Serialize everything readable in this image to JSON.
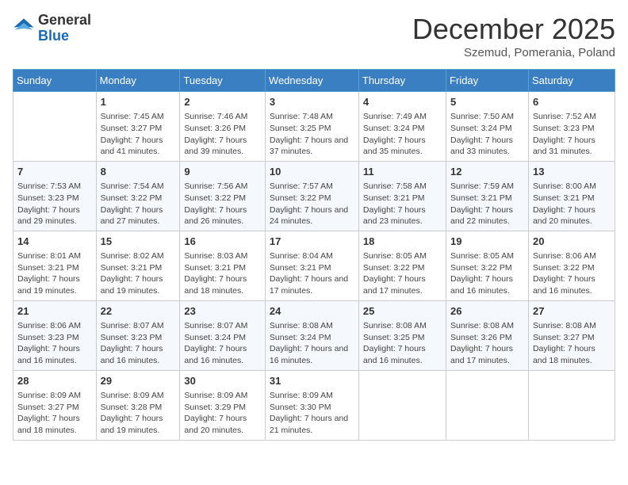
{
  "header": {
    "logo_general": "General",
    "logo_blue": "Blue",
    "month_title": "December 2025",
    "subtitle": "Szemud, Pomerania, Poland"
  },
  "days_of_week": [
    "Sunday",
    "Monday",
    "Tuesday",
    "Wednesday",
    "Thursday",
    "Friday",
    "Saturday"
  ],
  "weeks": [
    [
      {
        "day": "",
        "sunrise": "",
        "sunset": "",
        "daylight": ""
      },
      {
        "day": "1",
        "sunrise": "7:45 AM",
        "sunset": "3:27 PM",
        "daylight": "7 hours and 41 minutes."
      },
      {
        "day": "2",
        "sunrise": "7:46 AM",
        "sunset": "3:26 PM",
        "daylight": "7 hours and 39 minutes."
      },
      {
        "day": "3",
        "sunrise": "7:48 AM",
        "sunset": "3:25 PM",
        "daylight": "7 hours and 37 minutes."
      },
      {
        "day": "4",
        "sunrise": "7:49 AM",
        "sunset": "3:24 PM",
        "daylight": "7 hours and 35 minutes."
      },
      {
        "day": "5",
        "sunrise": "7:50 AM",
        "sunset": "3:24 PM",
        "daylight": "7 hours and 33 minutes."
      },
      {
        "day": "6",
        "sunrise": "7:52 AM",
        "sunset": "3:23 PM",
        "daylight": "7 hours and 31 minutes."
      }
    ],
    [
      {
        "day": "7",
        "sunrise": "7:53 AM",
        "sunset": "3:23 PM",
        "daylight": "7 hours and 29 minutes."
      },
      {
        "day": "8",
        "sunrise": "7:54 AM",
        "sunset": "3:22 PM",
        "daylight": "7 hours and 27 minutes."
      },
      {
        "day": "9",
        "sunrise": "7:56 AM",
        "sunset": "3:22 PM",
        "daylight": "7 hours and 26 minutes."
      },
      {
        "day": "10",
        "sunrise": "7:57 AM",
        "sunset": "3:22 PM",
        "daylight": "7 hours and 24 minutes."
      },
      {
        "day": "11",
        "sunrise": "7:58 AM",
        "sunset": "3:21 PM",
        "daylight": "7 hours and 23 minutes."
      },
      {
        "day": "12",
        "sunrise": "7:59 AM",
        "sunset": "3:21 PM",
        "daylight": "7 hours and 22 minutes."
      },
      {
        "day": "13",
        "sunrise": "8:00 AM",
        "sunset": "3:21 PM",
        "daylight": "7 hours and 20 minutes."
      }
    ],
    [
      {
        "day": "14",
        "sunrise": "8:01 AM",
        "sunset": "3:21 PM",
        "daylight": "7 hours and 19 minutes."
      },
      {
        "day": "15",
        "sunrise": "8:02 AM",
        "sunset": "3:21 PM",
        "daylight": "7 hours and 19 minutes."
      },
      {
        "day": "16",
        "sunrise": "8:03 AM",
        "sunset": "3:21 PM",
        "daylight": "7 hours and 18 minutes."
      },
      {
        "day": "17",
        "sunrise": "8:04 AM",
        "sunset": "3:21 PM",
        "daylight": "7 hours and 17 minutes."
      },
      {
        "day": "18",
        "sunrise": "8:05 AM",
        "sunset": "3:22 PM",
        "daylight": "7 hours and 17 minutes."
      },
      {
        "day": "19",
        "sunrise": "8:05 AM",
        "sunset": "3:22 PM",
        "daylight": "7 hours and 16 minutes."
      },
      {
        "day": "20",
        "sunrise": "8:06 AM",
        "sunset": "3:22 PM",
        "daylight": "7 hours and 16 minutes."
      }
    ],
    [
      {
        "day": "21",
        "sunrise": "8:06 AM",
        "sunset": "3:23 PM",
        "daylight": "7 hours and 16 minutes."
      },
      {
        "day": "22",
        "sunrise": "8:07 AM",
        "sunset": "3:23 PM",
        "daylight": "7 hours and 16 minutes."
      },
      {
        "day": "23",
        "sunrise": "8:07 AM",
        "sunset": "3:24 PM",
        "daylight": "7 hours and 16 minutes."
      },
      {
        "day": "24",
        "sunrise": "8:08 AM",
        "sunset": "3:24 PM",
        "daylight": "7 hours and 16 minutes."
      },
      {
        "day": "25",
        "sunrise": "8:08 AM",
        "sunset": "3:25 PM",
        "daylight": "7 hours and 16 minutes."
      },
      {
        "day": "26",
        "sunrise": "8:08 AM",
        "sunset": "3:26 PM",
        "daylight": "7 hours and 17 minutes."
      },
      {
        "day": "27",
        "sunrise": "8:08 AM",
        "sunset": "3:27 PM",
        "daylight": "7 hours and 18 minutes."
      }
    ],
    [
      {
        "day": "28",
        "sunrise": "8:09 AM",
        "sunset": "3:27 PM",
        "daylight": "7 hours and 18 minutes."
      },
      {
        "day": "29",
        "sunrise": "8:09 AM",
        "sunset": "3:28 PM",
        "daylight": "7 hours and 19 minutes."
      },
      {
        "day": "30",
        "sunrise": "8:09 AM",
        "sunset": "3:29 PM",
        "daylight": "7 hours and 20 minutes."
      },
      {
        "day": "31",
        "sunrise": "8:09 AM",
        "sunset": "3:30 PM",
        "daylight": "7 hours and 21 minutes."
      },
      {
        "day": "",
        "sunrise": "",
        "sunset": "",
        "daylight": ""
      },
      {
        "day": "",
        "sunrise": "",
        "sunset": "",
        "daylight": ""
      },
      {
        "day": "",
        "sunrise": "",
        "sunset": "",
        "daylight": ""
      }
    ]
  ],
  "labels": {
    "sunrise": "Sunrise:",
    "sunset": "Sunset:",
    "daylight": "Daylight:"
  }
}
